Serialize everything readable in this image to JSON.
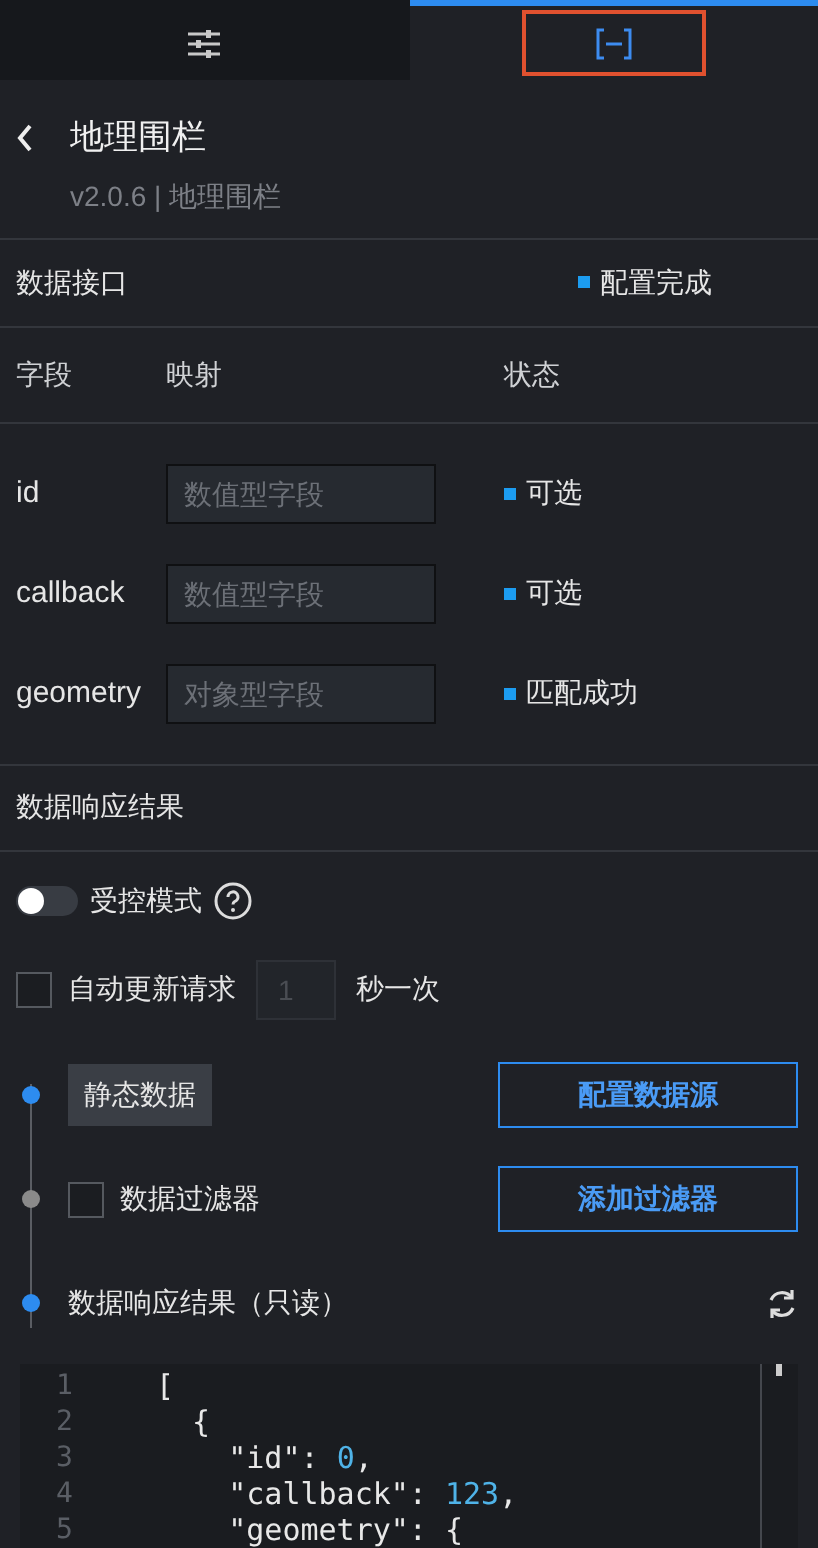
{
  "tabs": [
    {
      "kind": "settings",
      "selected": false
    },
    {
      "kind": "data",
      "selected": true,
      "highlighted": true
    }
  ],
  "header": {
    "title": "地理围栏",
    "subtitle": "v2.0.6 | 地理围栏"
  },
  "data_interface": {
    "title": "数据接口",
    "status": "配置完成"
  },
  "mapping": {
    "columns": [
      "字段",
      "映射",
      "状态"
    ],
    "rows": [
      {
        "field": "id",
        "placeholder": "数值型字段",
        "status": "可选"
      },
      {
        "field": "callback",
        "placeholder": "数值型字段",
        "status": "可选"
      },
      {
        "field": "geometry",
        "placeholder": "对象型字段",
        "status": "匹配成功"
      }
    ]
  },
  "response_section": {
    "title": "数据响应结果"
  },
  "controlled_mode": {
    "label": "受控模式",
    "on": false
  },
  "auto_update": {
    "label": "自动更新请求",
    "checked": false,
    "placeholder": "1",
    "unit": "秒一次"
  },
  "steps": [
    {
      "kind": "tag",
      "label": "静态数据",
      "color": "#2d8cf0",
      "button": "配置数据源"
    },
    {
      "kind": "checkbox",
      "label": "数据过滤器",
      "checked": false,
      "color": "#8a8a8a",
      "button": "添加过滤器"
    },
    {
      "kind": "text",
      "label": "数据响应结果（只读）",
      "color": "#2d8cf0"
    }
  ],
  "code": [
    {
      "number": "1",
      "tokens": [
        {
          "kind": "plain",
          "text": "["
        }
      ]
    },
    {
      "number": "2",
      "tokens": [
        {
          "kind": "plain",
          "text": "  {"
        }
      ]
    },
    {
      "number": "3",
      "tokens": [
        {
          "kind": "plain",
          "text": "    \"id\": "
        },
        {
          "kind": "number",
          "text": "0"
        },
        {
          "kind": "plain",
          "text": ","
        }
      ]
    },
    {
      "number": "4",
      "tokens": [
        {
          "kind": "plain",
          "text": "    \"callback\": "
        },
        {
          "kind": "number",
          "text": "123"
        },
        {
          "kind": "plain",
          "text": ","
        }
      ]
    },
    {
      "number": "5",
      "tokens": [
        {
          "kind": "plain",
          "text": "    \"geometry\": {"
        }
      ]
    }
  ]
}
